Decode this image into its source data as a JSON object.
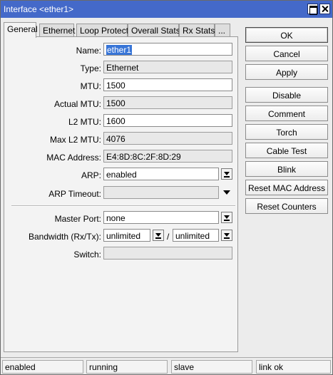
{
  "window": {
    "title": "Interface <ether1>"
  },
  "tabs": [
    {
      "label": "General",
      "active": true
    },
    {
      "label": "Ethernet"
    },
    {
      "label": "Loop Protect"
    },
    {
      "label": "Overall Stats"
    },
    {
      "label": "Rx Stats"
    },
    {
      "label": "..."
    }
  ],
  "form": {
    "name": {
      "label": "Name:",
      "value": "ether1"
    },
    "type": {
      "label": "Type:",
      "value": "Ethernet"
    },
    "mtu": {
      "label": "MTU:",
      "value": "1500"
    },
    "actual_mtu": {
      "label": "Actual MTU:",
      "value": "1500"
    },
    "l2_mtu": {
      "label": "L2 MTU:",
      "value": "1600"
    },
    "max_l2_mtu": {
      "label": "Max L2 MTU:",
      "value": "4076"
    },
    "mac_address": {
      "label": "MAC Address:",
      "value": "E4:8D:8C:2F:8D:29"
    },
    "arp": {
      "label": "ARP:",
      "value": "enabled"
    },
    "arp_timeout": {
      "label": "ARP Timeout:",
      "value": ""
    },
    "master_port": {
      "label": "Master Port:",
      "value": "none"
    },
    "bandwidth": {
      "label": "Bandwidth (Rx/Tx):",
      "rx": "unlimited",
      "separator": "/",
      "tx": "unlimited"
    },
    "switch": {
      "label": "Switch:",
      "value": ""
    }
  },
  "buttons": {
    "ok": "OK",
    "cancel": "Cancel",
    "apply": "Apply",
    "disable": "Disable",
    "comment": "Comment",
    "torch": "Torch",
    "cable_test": "Cable Test",
    "blink": "Blink",
    "reset_mac": "Reset MAC Address",
    "reset_counters": "Reset Counters"
  },
  "status": [
    "enabled",
    "running",
    "slave",
    "link ok"
  ]
}
